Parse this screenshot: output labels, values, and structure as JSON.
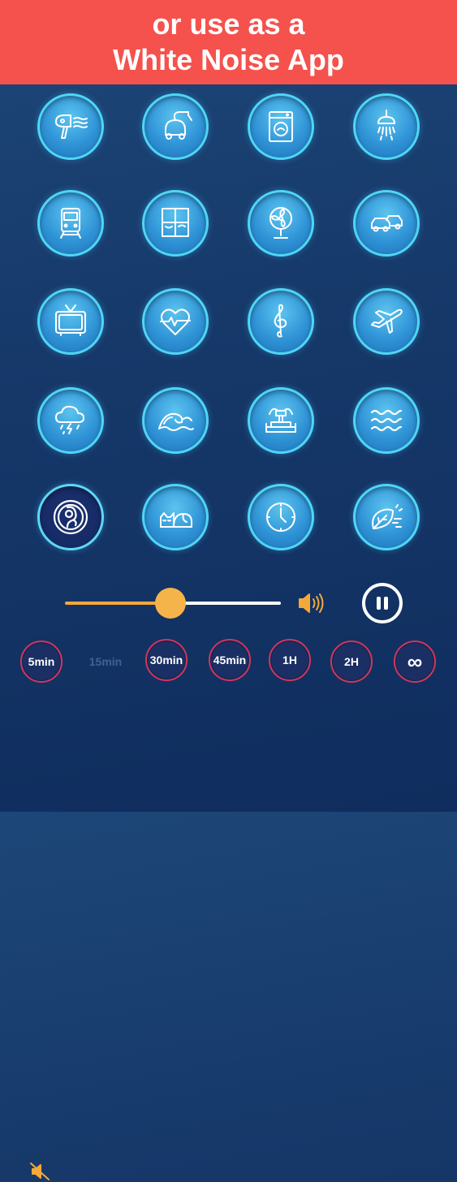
{
  "banner": {
    "line1": "or use as a",
    "line2": "White Noise App"
  },
  "sounds": [
    {
      "icon": "hair-dryer-icon"
    },
    {
      "icon": "vacuum-cleaner-icon"
    },
    {
      "icon": "washing-machine-icon"
    },
    {
      "icon": "shower-icon"
    },
    {
      "icon": "train-icon"
    },
    {
      "icon": "window-icon"
    },
    {
      "icon": "fan-icon"
    },
    {
      "icon": "cars-icon"
    },
    {
      "icon": "tv-icon"
    },
    {
      "icon": "heartbeat-icon"
    },
    {
      "icon": "treble-clef-icon"
    },
    {
      "icon": "airplane-icon"
    },
    {
      "icon": "thunderstorm-icon"
    },
    {
      "icon": "ocean-wave-icon"
    },
    {
      "icon": "fountain-icon"
    },
    {
      "icon": "water-waves-icon"
    },
    {
      "icon": "baby-womb-icon",
      "active": true
    },
    {
      "icon": "sleeping-cat-icon"
    },
    {
      "icon": "clock-icon"
    },
    {
      "icon": "leaf-wind-icon"
    }
  ],
  "volume": {
    "level": 0.49,
    "mute_icon": "speaker-mute-icon",
    "loud_icon": "speaker-loud-icon"
  },
  "playback": {
    "icon": "pause-icon"
  },
  "timers": [
    "5min",
    "15min",
    "30min",
    "45min",
    "1H",
    "2H",
    "∞"
  ],
  "selected_timer": "15min",
  "colors": {
    "banner": "#f5524d",
    "accent": "#f5a83a",
    "ring": "#4fd6f5",
    "timer_border": "#d2365a"
  }
}
